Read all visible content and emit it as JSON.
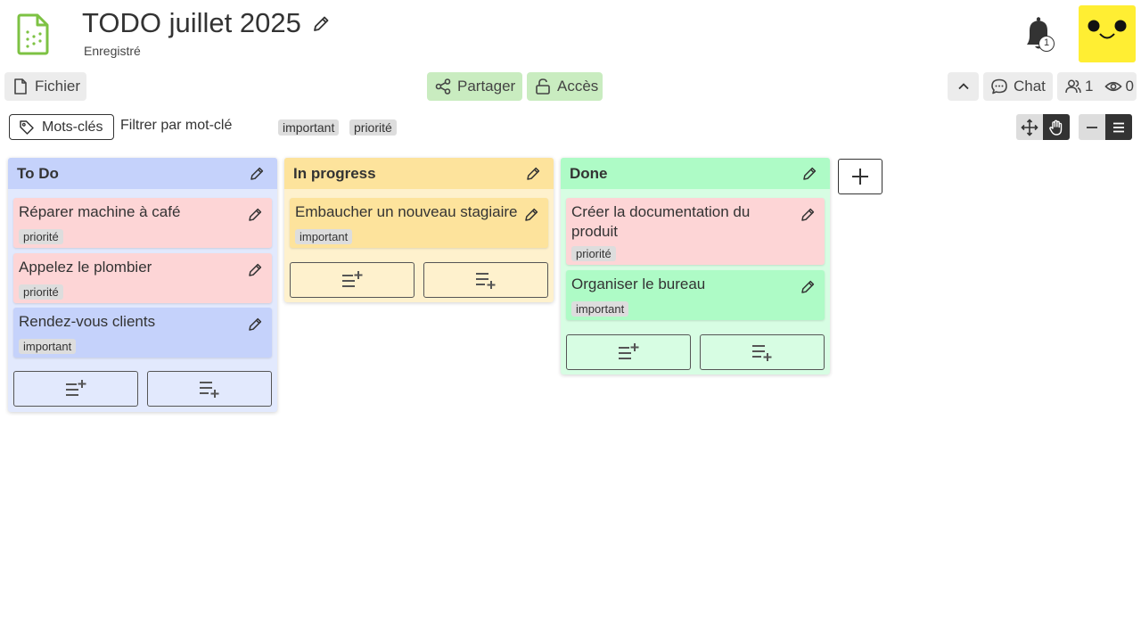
{
  "header": {
    "title": "TODO juillet 2025",
    "status": "Enregistré",
    "notification_count": "1"
  },
  "toolbar": {
    "file_label": "Fichier",
    "share_label": "Partager",
    "access_label": "Accès",
    "chat_label": "Chat",
    "users_count": "1",
    "viewers_count": "0"
  },
  "filter": {
    "keywords_label": "Mots-clés",
    "placeholder": "Filtrer par mot-clé",
    "tags": [
      "important",
      "priorité"
    ]
  },
  "columns": [
    {
      "title": "To Do",
      "cards": [
        {
          "title": "Réparer machine à café",
          "tag": "priorité"
        },
        {
          "title": "Appelez le plombier",
          "tag": "priorité"
        },
        {
          "title": "Rendez-vous clients",
          "tag": "important"
        }
      ]
    },
    {
      "title": "In progress",
      "cards": [
        {
          "title": "Embaucher un nouveau stagiaire",
          "tag": "important"
        }
      ]
    },
    {
      "title": "Done",
      "cards": [
        {
          "title": "Créer la documentation du produit",
          "tag": "priorité"
        },
        {
          "title": "Organiser le bureau",
          "tag": "important"
        }
      ]
    }
  ],
  "colors": {
    "todo_header": "#c5d2fb",
    "todo_body": "#e2e9fd",
    "progress_header": "#fde39c",
    "progress_body": "#fef1cd",
    "done_header": "#aefbc6",
    "done_body": "#d7fde3",
    "card_red": "#fdd5d6",
    "card_blue": "#c5d2fb",
    "card_yellow": "#fde39c",
    "card_green": "#aefbc6",
    "accent_green": "#c9ecc0",
    "avatar": "#ffee33"
  }
}
